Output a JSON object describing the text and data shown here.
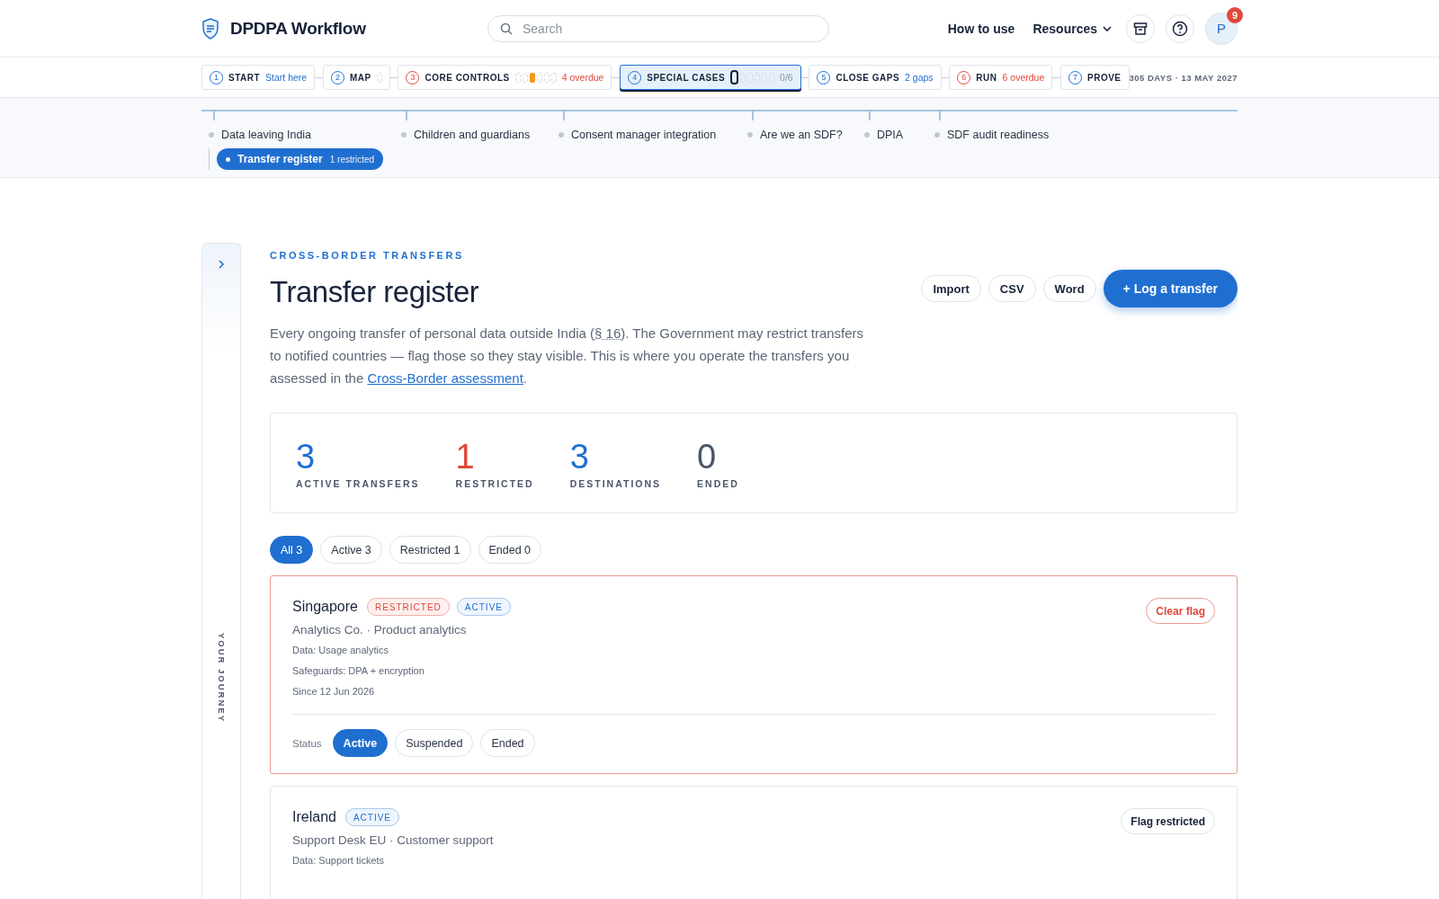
{
  "header": {
    "title": "DPDPA Workflow",
    "search": {
      "placeholder": "Search"
    },
    "links": [
      {
        "label": "How to use",
        "kind": "plain"
      },
      {
        "label": "Resources",
        "kind": "menu"
      }
    ],
    "avatar": "P",
    "notifications": "9"
  },
  "steps": [
    {
      "number": "1",
      "label": "START",
      "note": "Start here",
      "overdue": false,
      "selected": false
    },
    {
      "number": "2",
      "label": "MAP",
      "overdue": false,
      "selected": false,
      "segments": [
        {
          "current": false,
          "warning": false
        }
      ]
    },
    {
      "number": "3",
      "label": "CORE CONTROLS",
      "note": "4 overdue",
      "overdue": true,
      "selected": false,
      "segments": [
        {
          "current": false,
          "warning": false
        },
        {
          "current": false,
          "warning": false
        },
        {
          "current": false,
          "warning": true
        },
        {
          "current": false,
          "warning": false
        },
        {
          "current": false,
          "warning": false
        },
        {
          "current": false,
          "warning": false
        }
      ]
    },
    {
      "number": "4",
      "label": "SPECIAL CASES",
      "note": "0/6",
      "overdue": false,
      "selected": true,
      "segments": [
        {
          "current": true,
          "warning": false
        },
        {
          "current": false,
          "warning": false
        },
        {
          "current": false,
          "warning": false
        },
        {
          "current": false,
          "warning": false
        },
        {
          "current": false,
          "warning": false
        },
        {
          "current": false,
          "warning": false
        }
      ]
    },
    {
      "number": "5",
      "label": "CLOSE GAPS",
      "note": "2 gaps",
      "overdue": false,
      "selected": false
    },
    {
      "number": "6",
      "label": "RUN",
      "note": "6 overdue",
      "overdue": true,
      "selected": false
    },
    {
      "number": "7",
      "label": "PROVE",
      "overdue": false,
      "selected": false
    }
  ],
  "deadline": "305 DAYS · 13 MAY 2027",
  "substeps": [
    {
      "label": "Data leaving India",
      "selected": false,
      "children": [
        {
          "label": "Transfer register",
          "badge": "1 restricted",
          "selected": true
        }
      ]
    },
    {
      "label": "Children and guardians",
      "selected": false
    },
    {
      "label": "Consent manager integration",
      "selected": false
    },
    {
      "label": "Are we an SDF?",
      "selected": false
    },
    {
      "label": "DPIA",
      "selected": false
    },
    {
      "label": "SDF audit readiness",
      "selected": false
    }
  ],
  "sidebar": {
    "label": "YOUR JOURNEY",
    "expanded": false
  },
  "page": {
    "eyebrow": "CROSS-BORDER TRANSFERS",
    "title": "Transfer register",
    "description": [
      {
        "kind": "text",
        "text": "Every ongoing transfer of personal data outside India ("
      },
      {
        "kind": "abbr",
        "text": "§ 16"
      },
      {
        "kind": "text",
        "text": "). The Government may restrict transfers to notified countries — flag those so they stay visible. This is where you operate the transfers you assessed in the "
      },
      {
        "kind": "link",
        "text": "Cross-Border assessment"
      },
      {
        "kind": "text",
        "text": "."
      }
    ],
    "actions": [
      {
        "label": "Import",
        "kind": "secondary"
      },
      {
        "label": "CSV",
        "kind": "secondary"
      },
      {
        "label": "Word",
        "kind": "secondary"
      },
      {
        "label": "+ Log a transfer",
        "kind": "primary"
      }
    ]
  },
  "stats": [
    {
      "value": "3",
      "label": "ACTIVE TRANSFERS",
      "color": "#1f6fd1"
    },
    {
      "value": "1",
      "label": "RESTRICTED",
      "color": "#e0483a"
    },
    {
      "value": "3",
      "label": "DESTINATIONS",
      "color": "#1f6fd1"
    },
    {
      "value": "0",
      "label": "ENDED",
      "color": "#4a5568"
    }
  ],
  "filters": [
    {
      "label": "All 3",
      "selected": true
    },
    {
      "label": "Active 3",
      "selected": false
    },
    {
      "label": "Restricted 1",
      "selected": false
    },
    {
      "label": "Ended 0",
      "selected": false
    }
  ],
  "transfers": [
    {
      "country": "Singapore",
      "restricted": true,
      "tags": [
        {
          "label": "RESTRICTED",
          "kind": "restricted"
        },
        {
          "label": "ACTIVE",
          "kind": "active"
        }
      ],
      "recipient": "Analytics Co. · Product analytics",
      "details": [
        "Data: Usage analytics",
        "Safeguards: DPA + encryption",
        "Since 12 Jun 2026"
      ],
      "flag_action": "Clear flag",
      "status_label": "Status",
      "statuses": [
        {
          "label": "Active",
          "selected": true
        },
        {
          "label": "Suspended",
          "selected": false
        },
        {
          "label": "Ended",
          "selected": false
        }
      ]
    },
    {
      "country": "Ireland",
      "restricted": false,
      "tags": [
        {
          "label": "ACTIVE",
          "kind": "active"
        }
      ],
      "recipient": "Support Desk EU · Customer support",
      "details": [
        "Data: Support tickets"
      ],
      "flag_action": "Flag restricted"
    }
  ]
}
